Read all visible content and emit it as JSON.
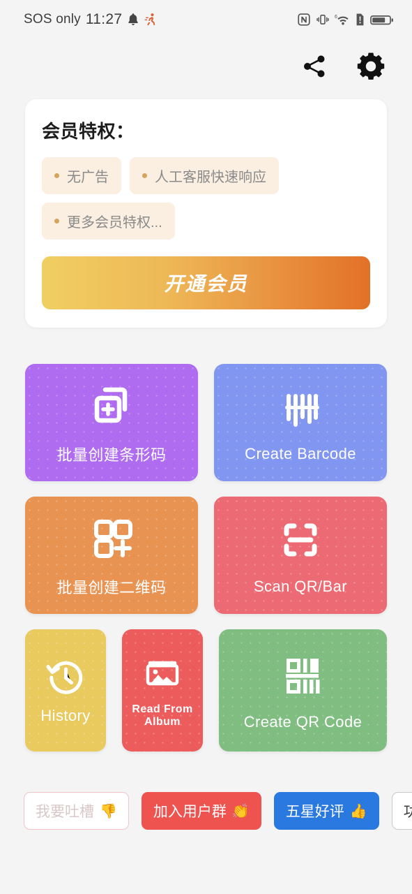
{
  "status_bar": {
    "carrier": "SOS only",
    "time": "11:27",
    "left_icons": [
      "bell-icon",
      "running-person-icon"
    ],
    "right_icons": [
      "nfc-icon",
      "vibrate-icon",
      "wifi6-icon",
      "sim-alert-icon",
      "battery-icon"
    ]
  },
  "header": {
    "share_label": "share-icon",
    "settings_label": "gear-icon"
  },
  "member_card": {
    "title": "会员特权：",
    "privileges": [
      {
        "label": "无广告"
      },
      {
        "label": "人工客服快速响应"
      },
      {
        "label": "更多会员特权..."
      }
    ],
    "cta_label": "开通会员",
    "chip_bg": "#faefe0",
    "bullet_color": "#d8a45c",
    "cta_gradient_from": "#f0cf62",
    "cta_gradient_to": "#e27127"
  },
  "tiles": {
    "batch_barcode": {
      "label": "批量创建条形码",
      "color": "#b06cf0",
      "icon": "duplicate-plus-icon"
    },
    "create_barcode": {
      "label": "Create Barcode",
      "color": "#8096f0",
      "icon": "barcode-icon"
    },
    "batch_qrcode": {
      "label": "批量创建二维码",
      "color": "#e89352",
      "icon": "qr-squares-plus-icon"
    },
    "scan_qr_bar": {
      "label": "Scan QR/Bar",
      "color": "#ec6a73",
      "icon": "scan-frame-icon"
    },
    "history": {
      "label": "History",
      "color": "#e8ca5e",
      "icon": "clock-rewind-icon"
    },
    "read_album": {
      "label": "Read From Album",
      "color": "#ec5c5c",
      "icon": "photo-icon"
    },
    "create_qrcode": {
      "label": "Create QR Code",
      "color": "#7fbd81",
      "icon": "qr-code-icon"
    }
  },
  "bottom_chips": [
    {
      "label": "我要吐槽",
      "emoji": "👎",
      "style": "outline-pink"
    },
    {
      "label": "加入用户群",
      "emoji": "👏",
      "style": "red"
    },
    {
      "label": "五星好评",
      "emoji": "👍",
      "style": "blue"
    },
    {
      "label": "功能提",
      "emoji": "",
      "style": "outline-gray"
    }
  ]
}
